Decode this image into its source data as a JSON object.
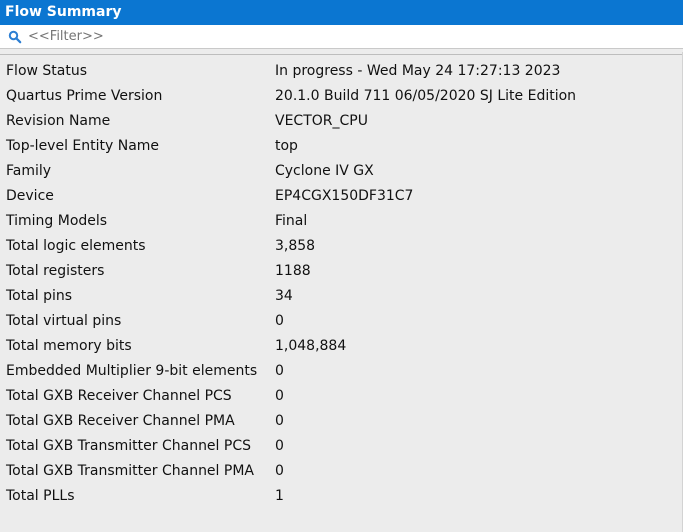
{
  "title": "Flow Summary",
  "filter": {
    "placeholder": "<<Filter>>",
    "value": "",
    "icon": "search-icon"
  },
  "colors": {
    "titlebar": "#0b76d1",
    "background": "#ececec",
    "text": "#111111"
  },
  "rows": [
    {
      "label": "Flow Status",
      "value": "In progress - Wed May 24 17:27:13 2023"
    },
    {
      "label": "Quartus Prime Version",
      "value": "20.1.0 Build 711 06/05/2020 SJ Lite Edition"
    },
    {
      "label": "Revision Name",
      "value": "VECTOR_CPU"
    },
    {
      "label": "Top-level Entity Name",
      "value": "top"
    },
    {
      "label": "Family",
      "value": "Cyclone IV GX"
    },
    {
      "label": "Device",
      "value": "EP4CGX150DF31C7"
    },
    {
      "label": "Timing Models",
      "value": "Final"
    },
    {
      "label": "Total logic elements",
      "value": "3,858"
    },
    {
      "label": "Total registers",
      "value": "1188"
    },
    {
      "label": "Total pins",
      "value": "34"
    },
    {
      "label": "Total virtual pins",
      "value": "0"
    },
    {
      "label": "Total memory bits",
      "value": "1,048,884"
    },
    {
      "label": "Embedded Multiplier 9-bit elements",
      "value": "0"
    },
    {
      "label": "Total GXB Receiver Channel PCS",
      "value": "0"
    },
    {
      "label": "Total GXB Receiver Channel PMA",
      "value": "0"
    },
    {
      "label": "Total GXB Transmitter Channel PCS",
      "value": "0"
    },
    {
      "label": "Total GXB Transmitter Channel PMA",
      "value": "0"
    },
    {
      "label": "Total PLLs",
      "value": "1"
    }
  ]
}
